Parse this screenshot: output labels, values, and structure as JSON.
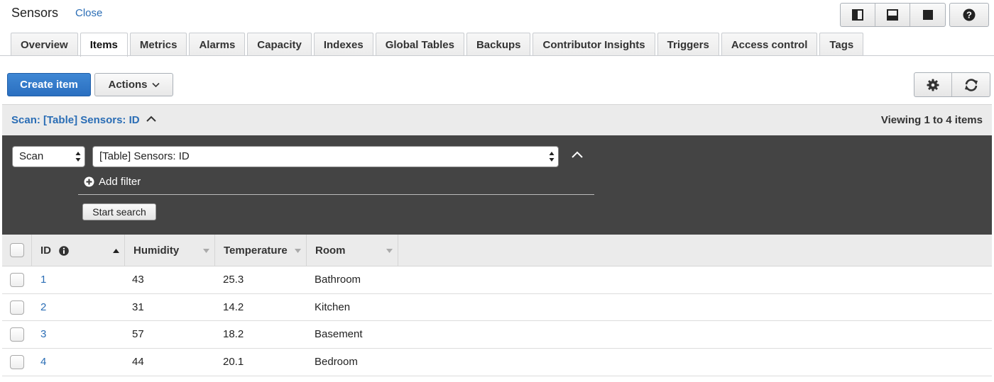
{
  "page": {
    "title": "Sensors",
    "close_label": "Close"
  },
  "tabs": [
    {
      "label": "Overview"
    },
    {
      "label": "Items",
      "active": true
    },
    {
      "label": "Metrics"
    },
    {
      "label": "Alarms"
    },
    {
      "label": "Capacity"
    },
    {
      "label": "Indexes"
    },
    {
      "label": "Global Tables"
    },
    {
      "label": "Backups"
    },
    {
      "label": "Contributor Insights"
    },
    {
      "label": "Triggers"
    },
    {
      "label": "Access control"
    },
    {
      "label": "Tags"
    }
  ],
  "toolbar": {
    "create_label": "Create item",
    "actions_label": "Actions",
    "settings_icon": "gear-icon",
    "refresh_icon": "refresh-icon"
  },
  "layout_icons": [
    "split-vertical-icon",
    "split-horizontal-icon",
    "full-screen-icon",
    "help-icon"
  ],
  "scan": {
    "title": "Scan: [Table] Sensors: ID",
    "viewing": "Viewing 1 to 4 items",
    "mode_value": "Scan",
    "target_value": "[Table] Sensors: ID",
    "add_filter_label": "Add filter",
    "start_search_label": "Start search"
  },
  "table": {
    "columns": [
      "ID",
      "Humidity",
      "Temperature",
      "Room"
    ],
    "rows": [
      {
        "id": "1",
        "humidity": "43",
        "temperature": "25.3",
        "room": "Bathroom"
      },
      {
        "id": "2",
        "humidity": "31",
        "temperature": "14.2",
        "room": "Kitchen"
      },
      {
        "id": "3",
        "humidity": "57",
        "temperature": "18.2",
        "room": "Basement"
      },
      {
        "id": "4",
        "humidity": "44",
        "temperature": "20.1",
        "room": "Bedroom"
      }
    ]
  },
  "colors": {
    "accent": "#2a6db5",
    "primary_button": "#2f78c8",
    "panel": "#444444"
  }
}
